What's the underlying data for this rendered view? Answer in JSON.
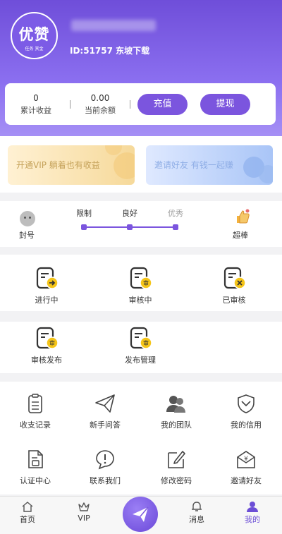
{
  "profile": {
    "logo_big": "优赞",
    "logo_small": "任务 赏金",
    "phone_blurred": "15597181788",
    "id_text": "ID:51757 东坡下载"
  },
  "stats": {
    "total_income_value": "0",
    "total_income_label": "累计收益",
    "balance_value": "0.00",
    "balance_label": "当前余额",
    "recharge_button": "充值",
    "withdraw_button": "提现"
  },
  "banners": {
    "vip": "开通VIP 躺着也有收益",
    "invite": "邀请好友 有钱一起赚"
  },
  "credit": {
    "left_label": "封号",
    "levels": [
      "限制",
      "良好",
      "优秀"
    ],
    "right_label": "超棒"
  },
  "status_items": [
    {
      "label": "进行中",
      "icon": "arrow-right-document-icon"
    },
    {
      "label": "审核中",
      "icon": "review-document-icon"
    },
    {
      "label": "已审核",
      "icon": "x-document-icon"
    }
  ],
  "publish_items": [
    {
      "label": "审核发布",
      "icon": "review-publish-icon"
    },
    {
      "label": "发布管理",
      "icon": "publish-manage-icon"
    }
  ],
  "menu": [
    {
      "label": "收支记录",
      "icon": "clipboard-icon"
    },
    {
      "label": "新手问答",
      "icon": "paper-plane-icon"
    },
    {
      "label": "我的团队",
      "icon": "team-icon"
    },
    {
      "label": "我的信用",
      "icon": "shield-icon"
    },
    {
      "label": "认证中心",
      "icon": "certificate-icon"
    },
    {
      "label": "联系我们",
      "icon": "chat-exclamation-icon"
    },
    {
      "label": "修改密码",
      "icon": "edit-icon"
    },
    {
      "label": "邀请好友",
      "icon": "invite-envelope-icon"
    }
  ],
  "tabs": [
    {
      "label": "首页",
      "icon": "home-icon"
    },
    {
      "label": "VIP",
      "icon": "crown-icon"
    },
    {
      "label": "",
      "icon": "send-icon"
    },
    {
      "label": "消息",
      "icon": "bell-icon"
    },
    {
      "label": "我的",
      "icon": "user-icon"
    }
  ],
  "colors": {
    "accent": "#7b55de",
    "header_top": "#6f4ed9",
    "badge_yellow": "#f5c518"
  }
}
